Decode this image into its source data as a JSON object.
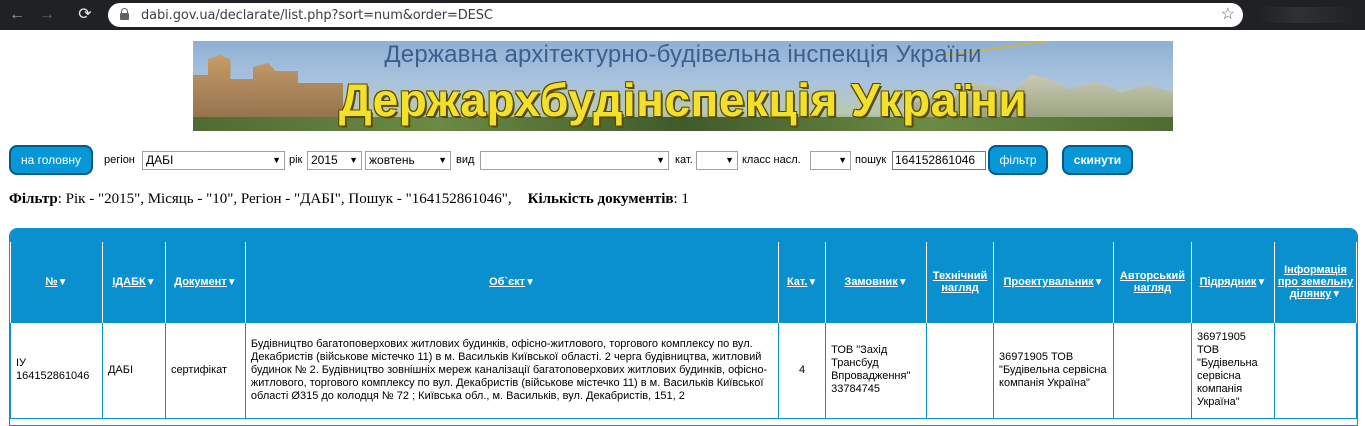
{
  "browser": {
    "back_icon": "←",
    "forward_icon": "→",
    "reload_icon": "⟳",
    "url": "dabi.gov.ua/declarate/list.php?sort=num&order=DESC",
    "bookmark_icon": "☆"
  },
  "banner": {
    "subtitle": "Державна архітектурно-будівельна інспекція України",
    "title": "Держархбудінспекція України"
  },
  "filters": {
    "home_label": "на головну",
    "region_label": "регіон",
    "region_value": "ДАБІ",
    "year_label": "рік",
    "year_value": "2015",
    "month_value": "жовтень",
    "type_label": "вид",
    "type_value": "",
    "cat_label": "кат.",
    "cat_value": "",
    "class_label": "класс насл.",
    "class_value": "",
    "search_label": "пошук",
    "search_value": "164152861046",
    "filter_label": "фільтр",
    "reset_label": "скинути"
  },
  "summary": {
    "filter_label": "Фільтр",
    "filter_text": ": Рік - \"2015\", Місяць - \"10\", Регіон - \"ДАБІ\", Пошук - \"164152861046\",",
    "count_label": "Кількість документів",
    "count_text": ": 1"
  },
  "table": {
    "sort_icon": "▼",
    "headers": [
      "№",
      "ІДАБК",
      "Документ",
      "Об`єкт",
      "Кат.",
      "Замовник",
      "Технічний нагляд",
      "Проектувальник",
      "Авторський нагляд",
      "Підрядник",
      "Інформація про земельну ділянку"
    ],
    "rows": [
      {
        "num": "ІУ 164152861046",
        "idabk": "ДАБІ",
        "document": "сертифікат",
        "object": "Будівництво багатоповерхових житлових будинків, офісно-житлового, торгового комплексу по вул. Декабристів (військове містечко 11) в м. Васильків Київської області. 2 черга будівництва, житловий будинок № 2. Будівництво зовнішніх мереж каналізації багатоповерхових житлових будинків, офісно-житлового, торгового комплексу по вул. Декабристів (військове містечко 11) в м. Васильків Київської області Ø315 до колодця № 72 ; Київська обл., м. Васильків, вул. Декабристів, 151, 2",
        "cat": "4",
        "customer": "ТОВ \"Захід Трансбуд Впровадження\" 33784745",
        "tech_supervision": "",
        "designer": "36971905 ТОВ \"Будівельна сервісна компанія Україна\"",
        "author_supervision": "",
        "contractor": "36971905 ТОВ \"Будівельна сервісна компанія Україна\"",
        "land_info": ""
      }
    ]
  }
}
